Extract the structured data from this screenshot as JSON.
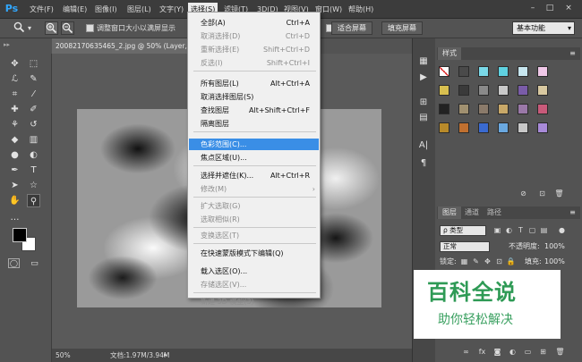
{
  "app": {
    "logo": "Ps",
    "menus": [
      "文件(F)",
      "编辑(E)",
      "图像(I)",
      "图层(L)",
      "文字(Y)",
      "选择(S)",
      "滤镜(T)",
      "3D(D)",
      "视图(V)",
      "窗口(W)",
      "帮助(H)"
    ],
    "active_menu": "选择(S)",
    "window_controls": [
      "–",
      "□",
      "×"
    ]
  },
  "options_bar": {
    "zoom_icon": "zoom-tool-icon",
    "zoom_in_icon": "zoom-in-icon",
    "zoom_out_icon": "zoom-out-icon",
    "resize_checkbox_label": "调整窗口大小以满屏显示",
    "fit_screen_label": "适合屏幕",
    "fill_screen_label": "填充屏幕",
    "workspace_value": "基本功能"
  },
  "document": {
    "tab_title": "20082170635465_2.jpg @ 50% (Layer, RG",
    "zoom_status": "50%",
    "doc_size": "文档:1.97M/3.94M"
  },
  "select_menu": {
    "items": [
      {
        "label": "全部(A)",
        "shortcut": "Ctrl+A",
        "state": "enabled"
      },
      {
        "label": "取消选择(D)",
        "shortcut": "Ctrl+D",
        "state": "disabled"
      },
      {
        "label": "重新选择(E)",
        "shortcut": "Shift+Ctrl+D",
        "state": "disabled"
      },
      {
        "label": "反选(I)",
        "shortcut": "Shift+Ctrl+I",
        "state": "disabled"
      },
      {
        "label": "所有图层(L)",
        "shortcut": "Alt+Ctrl+A",
        "state": "enabled"
      },
      {
        "label": "取消选择图层(S)",
        "shortcut": "",
        "state": "enabled"
      },
      {
        "label": "查找图层",
        "shortcut": "Alt+Shift+Ctrl+F",
        "state": "enabled"
      },
      {
        "label": "隔离图层",
        "shortcut": "",
        "state": "enabled"
      },
      {
        "label": "色彩范围(C)...",
        "shortcut": "",
        "state": "highlighted"
      },
      {
        "label": "焦点区域(U)...",
        "shortcut": "",
        "state": "enabled"
      },
      {
        "label": "选择并遮住(K)...",
        "shortcut": "Alt+Ctrl+R",
        "state": "enabled"
      },
      {
        "label": "修改(M)",
        "shortcut": "",
        "state": "disabled",
        "submenu": "›"
      },
      {
        "label": "扩大选取(G)",
        "shortcut": "",
        "state": "disabled"
      },
      {
        "label": "选取相似(R)",
        "shortcut": "",
        "state": "disabled"
      },
      {
        "label": "变换选区(T)",
        "shortcut": "",
        "state": "disabled"
      },
      {
        "label": "在快速蒙版模式下编辑(Q)",
        "shortcut": "",
        "state": "enabled"
      },
      {
        "label": "载入选区(O)...",
        "shortcut": "",
        "state": "enabled"
      },
      {
        "label": "存储选区(V)...",
        "shortcut": "",
        "state": "disabled"
      },
      {
        "label": "新建 3D 模型(3)",
        "shortcut": "",
        "state": "disabled"
      }
    ]
  },
  "styles_panel": {
    "tab": "样式",
    "swatch_colors": [
      "#ffffff",
      "#4a4a4a",
      "#7ad9e8",
      "#5fd1e0",
      "#c7e6ef",
      "#f0c8e8",
      "#d9c050",
      "#3a3a3a",
      "#8a8a8a",
      "#c9c9c9",
      "#7a5ca8",
      "#d8c8a0",
      "#222222",
      "#a09070",
      "#8a7a6a",
      "#c8a868",
      "#9a78a8",
      "#c85a7a",
      "#b88a2a",
      "#c07030",
      "#3a6ad0",
      "#6aa8e0",
      "#c8c8c8",
      "#a88ad8"
    ]
  },
  "layers_panel": {
    "tabs": [
      "图层",
      "通道",
      "路径"
    ],
    "filter_label": "ρ 类型",
    "blend_mode": "正常",
    "opacity_label": "不透明度:",
    "opacity_value": "100%",
    "lock_label": "锁定:",
    "fill_label": "填充:",
    "fill_value": "100%",
    "bottom_icons": [
      "link-icon",
      "fx-icon",
      "mask-icon",
      "adjustment-icon",
      "folder-icon",
      "new-layer-icon",
      "trash-icon"
    ]
  },
  "tools": [
    "move-tool-icon",
    "marquee-tool-icon",
    "lasso-tool-icon",
    "quick-select-tool-icon",
    "crop-tool-icon",
    "eyedropper-tool-icon",
    "healing-tool-icon",
    "brush-tool-icon",
    "stamp-tool-icon",
    "history-brush-tool-icon",
    "eraser-tool-icon",
    "gradient-tool-icon",
    "blur-tool-icon",
    "dodge-tool-icon",
    "pen-tool-icon",
    "type-tool-icon",
    "path-select-tool-icon",
    "shape-tool-icon",
    "hand-tool-icon",
    "zoom-tool-icon"
  ],
  "watermark": {
    "title": "百科全说",
    "subtitle": "助你轻松解决"
  }
}
